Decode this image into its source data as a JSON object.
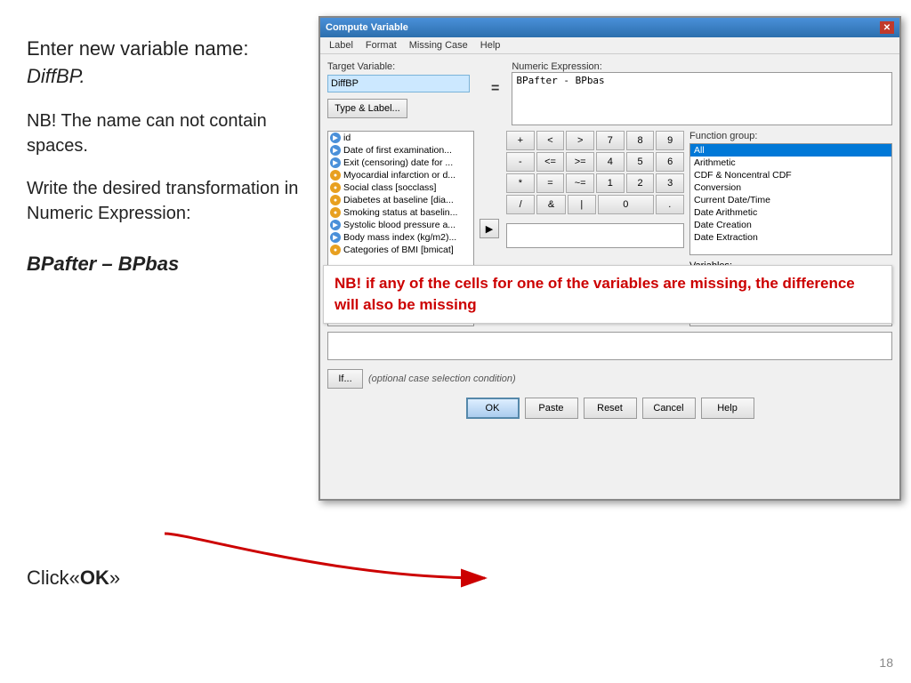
{
  "left_panel": {
    "instruction1": "Enter new variable name: ",
    "instruction1_italic": "DiffBP.",
    "nb1": "NB! The name can not contain spaces.",
    "write": "Write the desired transformation in Numeric Expression:",
    "formula": "BPafter – BPbas",
    "click_label": "Click«",
    "click_bold": "OK",
    "click_end": "»"
  },
  "page_number": "18",
  "window": {
    "title": "Compute Variable",
    "menu_items": [
      "Label",
      "Format",
      "Missing Case",
      "Help"
    ],
    "target_variable_label": "Target Variable:",
    "target_variable_value": "DiffBP",
    "type_label_btn": "Type & Label...",
    "equals": "=",
    "numeric_expression_label": "Numeric Expression:",
    "numeric_expression_value": "BPafter - BPbas",
    "variables": [
      {
        "name": "id",
        "type": "scale"
      },
      {
        "name": "Date of first examination...",
        "type": "scale"
      },
      {
        "name": "Exit (censoring) date for ...",
        "type": "scale"
      },
      {
        "name": "Myocardial infarction or d...",
        "type": "nominal"
      },
      {
        "name": "Social class [socclass]",
        "type": "nominal"
      },
      {
        "name": "Diabetes at baseline [dia...",
        "type": "nominal"
      },
      {
        "name": "Smoking status at baselin...",
        "type": "nominal"
      },
      {
        "name": "Systolic blood pressure a...",
        "type": "scale"
      },
      {
        "name": "Body mass index (kg/m2)...",
        "type": "scale"
      },
      {
        "name": "Categories of BMI [bmicat]",
        "type": "nominal"
      }
    ],
    "keypad": [
      [
        "+",
        "<",
        ">",
        "7",
        "8",
        "9"
      ],
      [
        "-",
        "<=",
        ">=",
        "4",
        "5",
        "6"
      ],
      [
        "*",
        "=",
        "~=",
        "1",
        "2",
        "3"
      ],
      [
        "/",
        "&",
        "|",
        "0",
        "."
      ]
    ],
    "function_group_label": "Function group:",
    "function_groups": [
      "All",
      "Arithmetic",
      "CDF & Noncentral CDF",
      "Conversion",
      "Current Date/Time",
      "Date Arithmetic",
      "Date Creation",
      "Date Extraction"
    ],
    "selected_function_group": "All",
    "variables_label": "Variables:",
    "if_btn": "If...",
    "optional_text": "(optional case selection condition)",
    "buttons": [
      "OK",
      "Paste",
      "Reset",
      "Cancel",
      "Help"
    ]
  },
  "warning": {
    "text": "NB! if any of the cells for one of the variables are missing, the difference will also be missing"
  }
}
